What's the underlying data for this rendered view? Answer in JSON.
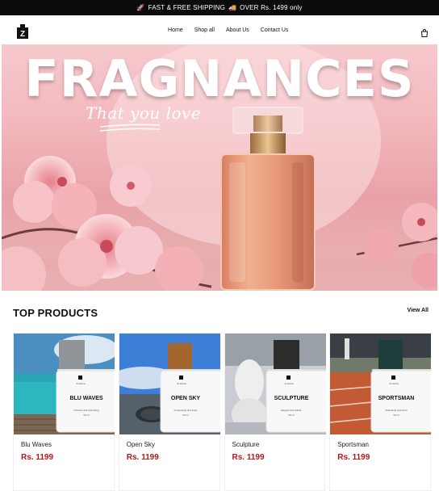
{
  "announcement": {
    "icon_left": "rocket-icon",
    "icon_mid": "truck-icon",
    "text_part1": "FAST & FREE SHIPPING",
    "text_part2": "OVER Rs. 1499 only"
  },
  "nav": {
    "logo_letter": "Z",
    "items": [
      {
        "label": "Home"
      },
      {
        "label": "Shop all"
      },
      {
        "label": "About Us"
      },
      {
        "label": "Contact Us"
      }
    ],
    "cart_icon": "shopping-bag-icon"
  },
  "hero": {
    "title": "FRAGNANCES",
    "subtitle": "That you love"
  },
  "products_section": {
    "title": "TOP PRODUCTS",
    "view_all": "View All",
    "items": [
      {
        "name": "Blu Waves",
        "price": "Rs. 1199",
        "label_brand": "Al Zehra",
        "label_name": "BLU WAVES",
        "label_desc": "Oceanic and refreshing",
        "label_volume": "50 ml",
        "cap_color": "#8f9598"
      },
      {
        "name": "Open Sky",
        "price": "Rs. 1199",
        "label_brand": "Al Zehra",
        "label_name": "OPEN SKY",
        "label_desc": "Invigorating and lively",
        "label_volume": "50 ml",
        "cap_color": "#a3662f"
      },
      {
        "name": "Sculpture",
        "price": "Rs. 1199",
        "label_brand": "Al Zehra",
        "label_name": "SCULPTURE",
        "label_desc": "Elegant and artistic",
        "label_volume": "50 ml",
        "cap_color": "#2d2d2d"
      },
      {
        "name": "Sportsman",
        "price": "Rs. 1199",
        "label_brand": "Al Zehra",
        "label_name": "SPORTSMAN",
        "label_desc": "Motivating and fresh",
        "label_volume": "50 ml",
        "cap_color": "#1f3d3a"
      }
    ]
  }
}
